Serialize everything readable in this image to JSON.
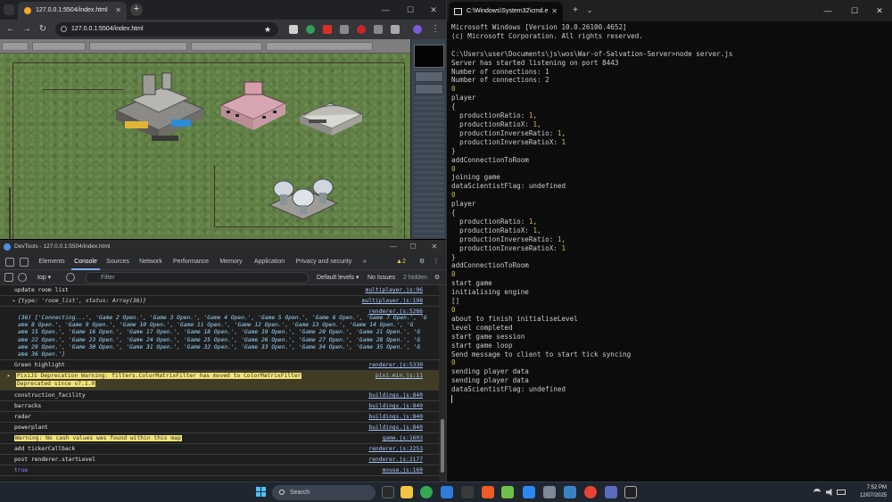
{
  "browser": {
    "tab_title": "127.0.0.1:5504/index.html",
    "address": "127.0.0.1:5504/index.html"
  },
  "devtools": {
    "window_title": "DevTools - 127.0.0.1:5504/index.html",
    "tabs": [
      "Elements",
      "Console",
      "Sources",
      "Network",
      "Performance",
      "Memory",
      "Application",
      "Privacy and security"
    ],
    "active_tab": "Console",
    "warning_count": "2",
    "context": "top",
    "filter_placeholder": "Filter",
    "levels": "Default levels",
    "issues": "No Issues",
    "hidden": "2 hidden",
    "logs": [
      {
        "msg": "update room list",
        "src": "multiplayer.js:96"
      },
      {
        "msg": "{type: 'room_list', status: Array(36)}",
        "src": "multiplayer.js:198"
      },
      {
        "src": "renderer.js:5286",
        "lines": [
          "(36) ['Connecting...', 'Game 2 Open.', 'Game 3 Open.', 'Game 4 Open.', 'Game 5 Open.', 'Game 6 Open.', 'Game 7 Open.', 'G",
          "ame 8 Open.', 'Game 9 Open.', 'Game 10 Open.', 'Game 11 Open.', 'Game 12 Open.', 'Game 13 Open.', 'Game 14 Open.', 'G",
          "ame 15 Open.', 'Game 16 Open.', 'Game 17 Open.', 'Game 18 Open.', 'Game 19 Open.', 'Game 20 Open.', 'Game 21 Open.', 'G",
          "ame 22 Open.', 'Game 23 Open.', 'Game 24 Open.', 'Game 25 Open.', 'Game 26 Open.', 'Game 27 Open.', 'Game 28 Open.', 'G",
          "ame 29 Open.', 'Game 30 Open.', 'Game 31 Open.', 'Game 32 Open.', 'Game 33 Open.', 'Game 34 Open.', 'Game 35 Open.', 'G",
          "ame 36 Open.']"
        ]
      },
      {
        "msg": "Green highlight",
        "src": "renderer.js:5330"
      },
      {
        "msg": "PixiJS Deprecation Warning: filters.ColorMatrixFilter has moved to ColorMatrixFilter",
        "msg2": "Deprecated since v7.1.0",
        "src": "pixi.min.js:11"
      },
      {
        "msg": "construction_facility",
        "src": "buildings.js:840"
      },
      {
        "msg": "barracks",
        "src": "buildings.js:840"
      },
      {
        "msg": "radar",
        "src": "buildings.js:840"
      },
      {
        "msg": "powerplant",
        "src": "buildings.js:840"
      },
      {
        "msg": "Warning: No cash values was found within this map",
        "src": "game.js:1603"
      },
      {
        "msg": "add tickerCallback",
        "src": "renderer.js:2253"
      },
      {
        "msg": "post renderer.startLevel",
        "src": "renderer.js:2177"
      },
      {
        "msg": "true",
        "src": "mouse.js:160"
      }
    ]
  },
  "terminal": {
    "tab_title": "C:\\Windows\\System32\\cmd.e",
    "lines": [
      "Microsoft Windows [Version 10.0.26100.4652]",
      "(c) Microsoft Corporation. All rights reserved.",
      "",
      "C:\\Users\\user\\Documents\\js\\wos\\War-of-Salvation-Server>node server.js",
      "Server has started listening on port 8443",
      "Number of connections: 1",
      "Number of connections: 2",
      "0",
      "player",
      "{",
      "  productionRatio: 1,",
      "  productionRatioX: 1,",
      "  productionInverseRatio: 1,",
      "  productionInverseRatioX: 1",
      "}",
      "addConnectionToRoom",
      "0",
      "joining game",
      "dataScientistFlag: undefined",
      "0",
      "player",
      "{",
      "  productionRatio: 1,",
      "  productionRatioX: 1,",
      "  productionInverseRatio: 1,",
      "  productionInverseRatioX: 1",
      "}",
      "addConnectionToRoom",
      "0",
      "start game",
      "initialising engine",
      "[]",
      "0",
      "about to finish initialiseLevel",
      "level completed",
      "start game session",
      "start game loop",
      "Send message to client to start tick syncing",
      "0",
      "sending player data",
      "sending player data",
      "dataScientistFlag: undefined"
    ]
  },
  "taskbar": {
    "search_placeholder": "Search",
    "time": "7:52 PM",
    "date": "12/07/2025"
  },
  "colors": {
    "accent": "#7cacf8",
    "warning_bg": "#413c26",
    "terminal_number": "#d7ba45",
    "grass": "#5f7d45"
  }
}
